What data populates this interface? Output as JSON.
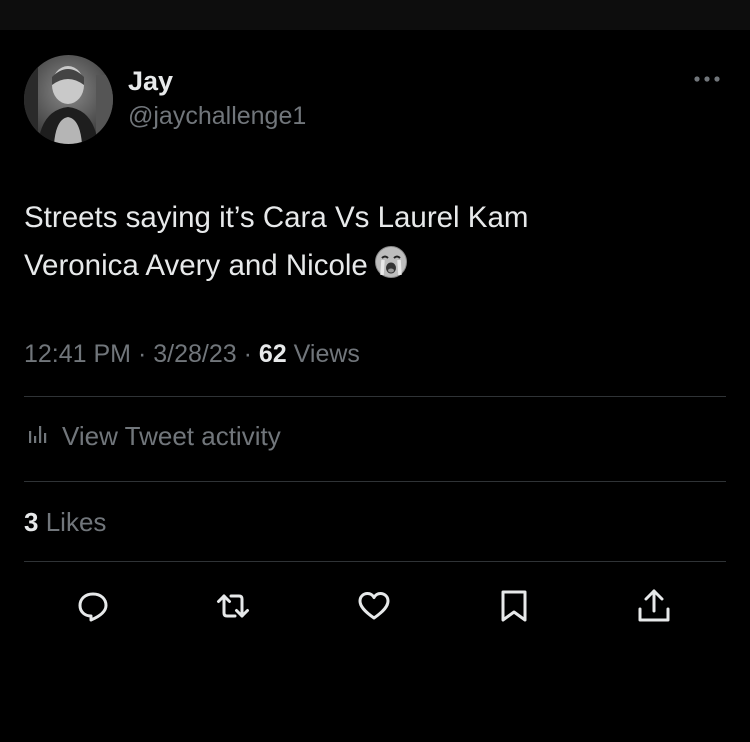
{
  "tweet": {
    "author": {
      "display_name": "Jay",
      "handle": "@jaychallenge1",
      "avatar_icon": "profile-photo"
    },
    "text_lines": [
      "Streets saying it’s Cara Vs Laurel Kam",
      "Veronica Avery and Nicole"
    ],
    "emoji": "loudly-crying-face",
    "time": "12:41 PM",
    "date": "3/28/23",
    "separator": "·",
    "views_count": "62",
    "views_label": "Views",
    "activity_label": "View Tweet activity",
    "likes_count": "3",
    "likes_label": "Likes"
  },
  "actions": [
    {
      "name": "reply",
      "icon": "speech-bubble-icon"
    },
    {
      "name": "retweet",
      "icon": "retweet-icon"
    },
    {
      "name": "like",
      "icon": "heart-icon"
    },
    {
      "name": "bookmark",
      "icon": "bookmark-icon"
    },
    {
      "name": "share",
      "icon": "share-icon"
    }
  ],
  "colors": {
    "background": "#000000",
    "primary_text": "#e7e9ea",
    "secondary_text": "#71767b",
    "divider": "#2f3336"
  }
}
